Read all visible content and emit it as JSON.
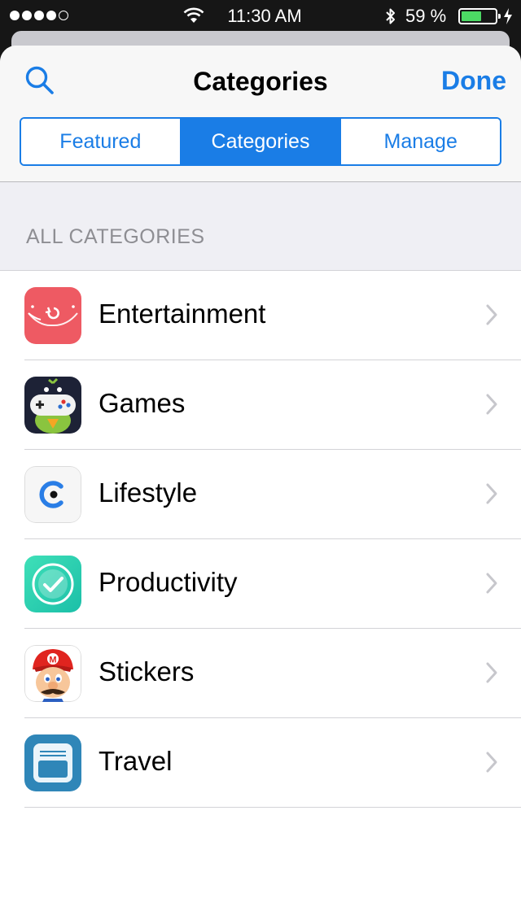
{
  "status_bar": {
    "signal_dots_filled": 4,
    "signal_dots_total": 5,
    "time": "11:30 AM",
    "battery_percent": "59 %",
    "battery_level": 0.59,
    "icons": [
      "wifi-icon",
      "bluetooth-icon",
      "battery-icon",
      "charging-bolt-icon"
    ]
  },
  "nav": {
    "title": "Categories",
    "done_label": "Done",
    "search_icon": "search-icon"
  },
  "tabs": [
    {
      "label": "Featured",
      "active": false
    },
    {
      "label": "Categories",
      "active": true
    },
    {
      "label": "Manage",
      "active": false
    }
  ],
  "section": {
    "header": "ALL CATEGORIES"
  },
  "categories": [
    {
      "label": "Entertainment",
      "icon": "entertainment-app-icon"
    },
    {
      "label": "Games",
      "icon": "games-parrot-controller-icon"
    },
    {
      "label": "Lifestyle",
      "icon": "lifestyle-c-icon"
    },
    {
      "label": "Productivity",
      "icon": "productivity-checkmark-icon"
    },
    {
      "label": "Stickers",
      "icon": "stickers-mario-icon"
    },
    {
      "label": "Travel",
      "icon": "travel-card-icon"
    }
  ],
  "colors": {
    "accent": "#1a7de6",
    "battery": "#4cd964",
    "section_bg": "#efeff4",
    "section_text": "#8e8e93"
  }
}
